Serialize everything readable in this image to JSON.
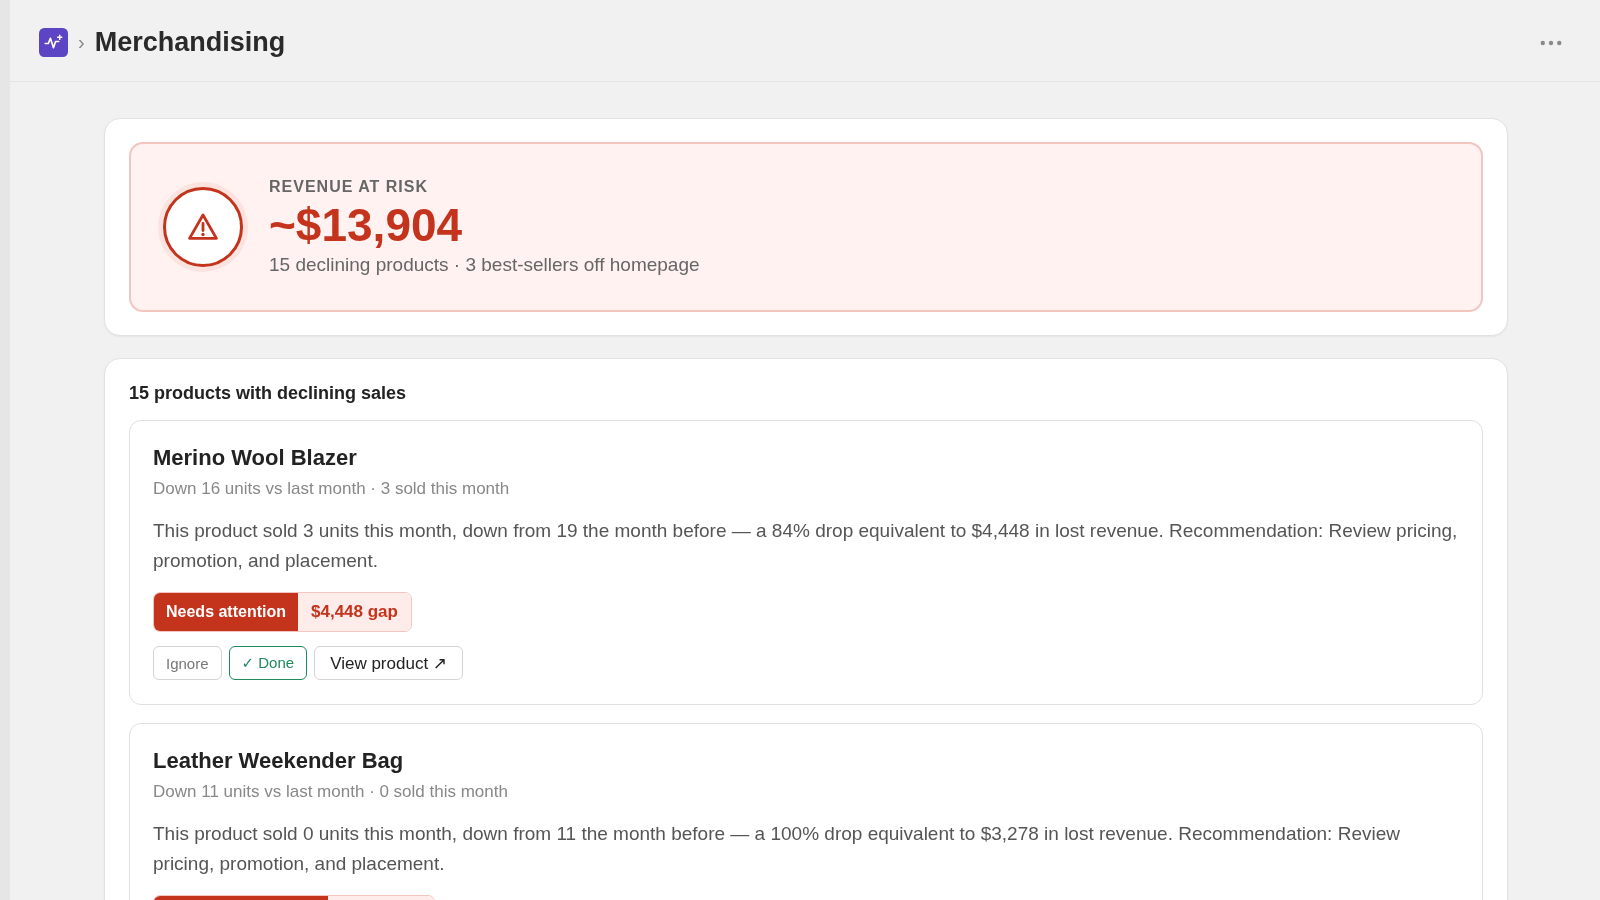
{
  "header": {
    "breadcrumb_separator": "›",
    "title": "Merchandising"
  },
  "risk": {
    "label": "REVENUE AT RISK",
    "amount": "~$13,904",
    "summary": "15 declining products · 3 best-sellers off homepage"
  },
  "declining": {
    "heading": "15 products with declining sales",
    "products": [
      {
        "name": "Merino Wool Blazer",
        "meta": "Down 16 units vs last month · 3 sold this month",
        "description": "This product sold 3 units this month, down from 19 the month before — a 84% drop equivalent to $4,448 in lost revenue. Recommendation: Review pricing, promotion, and placement.",
        "tag": {
          "kind": "needs_attention",
          "status": "Needs attention",
          "gap": "$4,448 gap"
        },
        "actions": [
          {
            "kind": "ignore",
            "label": "Ignore"
          },
          {
            "kind": "done",
            "label": "✓ Done"
          },
          {
            "kind": "link",
            "label": "View product ↗"
          }
        ]
      },
      {
        "name": "Leather Weekender Bag",
        "meta": "Down 11 units vs last month · 0 sold this month",
        "description": "This product sold 0 units this month, down from 11 the month before — a 100% drop equivalent to $3,278 in lost revenue. Recommendation: Review pricing, promotion, and placement.",
        "tag": {
          "kind": "needs_attention"
        }
      }
    ]
  }
}
